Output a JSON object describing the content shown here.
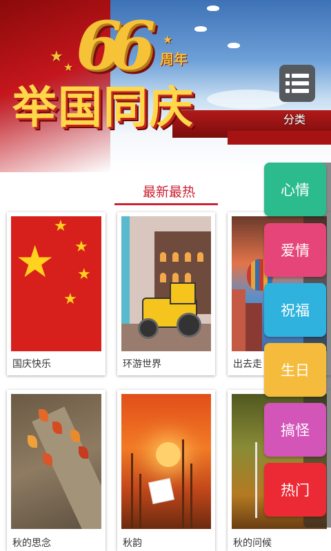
{
  "banner": {
    "number": "66",
    "suffix": "周年",
    "title": "举国同庆"
  },
  "category_button": {
    "label": "分类",
    "icon": "list-icon"
  },
  "section": {
    "title": "最新最热"
  },
  "cards": [
    {
      "caption": "国庆快乐"
    },
    {
      "caption": "环游世界"
    },
    {
      "caption": "出去走"
    },
    {
      "caption": "秋的思念"
    },
    {
      "caption": "秋韵"
    },
    {
      "caption": "秋的问候"
    }
  ],
  "side_menu": [
    {
      "label": "心情",
      "color": "#2bbb8d"
    },
    {
      "label": "爱情",
      "color": "#e6457a"
    },
    {
      "label": "祝福",
      "color": "#2fb2de"
    },
    {
      "label": "生日",
      "color": "#f5bb3c"
    },
    {
      "label": "搞怪",
      "color": "#d455b8"
    },
    {
      "label": "热门",
      "color": "#ec2a36"
    }
  ],
  "colors": {
    "accent": "#cc2233"
  }
}
